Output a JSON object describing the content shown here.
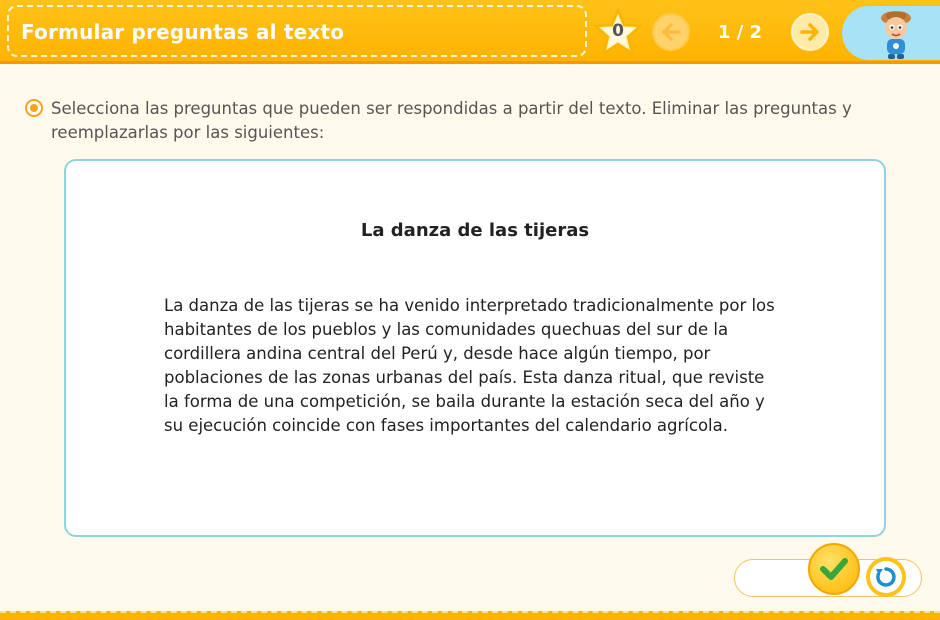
{
  "header": {
    "title": "Formular preguntas al texto",
    "score": "0",
    "page_indicator": "1 / 2",
    "prev_icon": "arrow-left-icon",
    "next_icon": "arrow-right-icon",
    "avatar": "student-avatar"
  },
  "instruction": {
    "text": "Selecciona las preguntas que pueden ser respondidas a partir del texto. Eliminar las preguntas y reemplazarlas por las siguientes:"
  },
  "reading": {
    "title": "La danza de las tijeras",
    "body": "La danza de las tijeras se ha venido interpretado tradicionalmente por los habitantes de los pueblos y las comunidades quechuas del sur de la cordillera andina central del Perú y, desde hace algún tiempo, por poblaciones de las zonas urbanas del país. Esta danza ritual, que reviste la forma de una competición, se baila durante la estación seca del año y su ejecución coincide con fases importantes del calendario agrícola."
  },
  "controls": {
    "check_icon": "check-icon",
    "reset_icon": "reset-icon"
  },
  "colors": {
    "accent": "#ffb300",
    "card_border": "#8fd3e0",
    "avatar_bg": "#a7e2f6"
  }
}
